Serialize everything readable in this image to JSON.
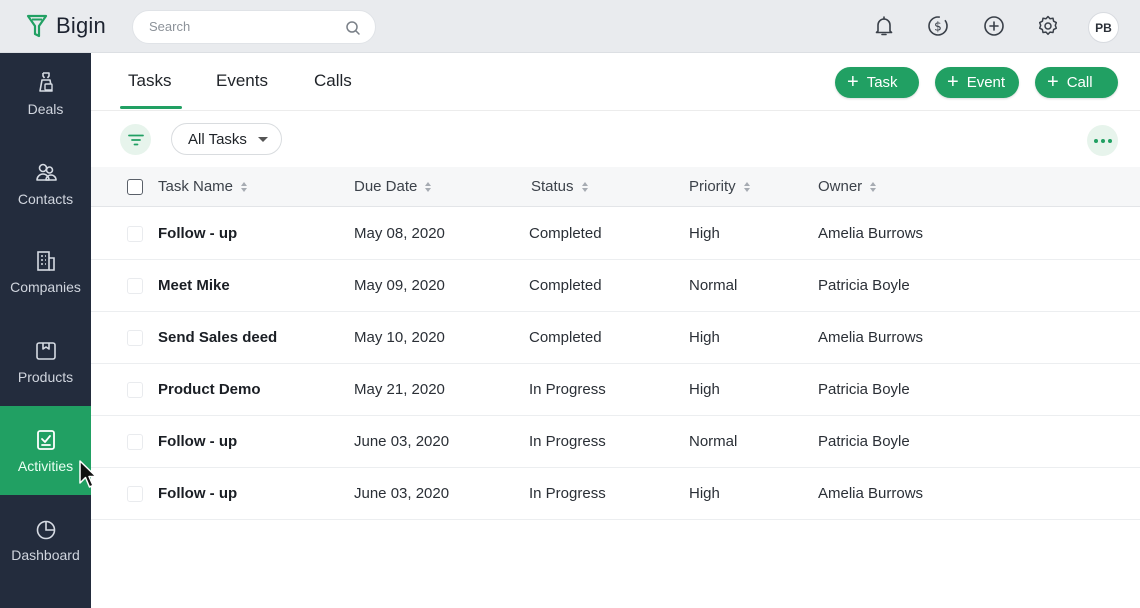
{
  "app": {
    "name": "Bigin",
    "brand_color": "#21a063",
    "sidebar_color": "#232c3d"
  },
  "search": {
    "placeholder": "Search",
    "icon": "search-icon"
  },
  "topbar": {
    "icons": [
      "bell-icon",
      "dollar-sync-icon",
      "plus-circle-icon",
      "gear-icon"
    ],
    "avatar_initials": "PB"
  },
  "sidebar": {
    "items": [
      {
        "label": "Deals",
        "icon": "deals-icon",
        "active": false
      },
      {
        "label": "Contacts",
        "icon": "contacts-icon",
        "active": false
      },
      {
        "label": "Companies",
        "icon": "companies-icon",
        "active": false
      },
      {
        "label": "Products",
        "icon": "products-icon",
        "active": false
      },
      {
        "label": "Activities",
        "icon": "activities-icon",
        "active": true
      },
      {
        "label": "Dashboard",
        "icon": "dashboard-icon",
        "active": false
      }
    ]
  },
  "tabs": [
    {
      "label": "Tasks",
      "active": true
    },
    {
      "label": "Events",
      "active": false
    },
    {
      "label": "Calls",
      "active": false
    }
  ],
  "actions": {
    "task_label": "Task",
    "event_label": "Event",
    "call_label": "Call"
  },
  "filter": {
    "view_label": "All Tasks"
  },
  "table": {
    "columns": [
      "Task Name",
      "Due Date",
      "Status",
      "Priority",
      "Owner"
    ],
    "rows": [
      {
        "name": "Follow - up",
        "due": "May 08, 2020",
        "status": "Completed",
        "priority": "High",
        "owner": "Amelia Burrows"
      },
      {
        "name": "Meet Mike",
        "due": "May 09, 2020",
        "status": "Completed",
        "priority": "Normal",
        "owner": "Patricia Boyle"
      },
      {
        "name": "Send Sales deed",
        "due": "May 10, 2020",
        "status": "Completed",
        "priority": "High",
        "owner": "Amelia Burrows"
      },
      {
        "name": "Product Demo",
        "due": "May 21, 2020",
        "status": "In Progress",
        "priority": "High",
        "owner": "Patricia Boyle"
      },
      {
        "name": "Follow - up",
        "due": "June 03, 2020",
        "status": "In Progress",
        "priority": "Normal",
        "owner": "Patricia Boyle"
      },
      {
        "name": "Follow - up",
        "due": "June 03, 2020",
        "status": "In Progress",
        "priority": "High",
        "owner": "Amelia Burrows"
      }
    ]
  }
}
